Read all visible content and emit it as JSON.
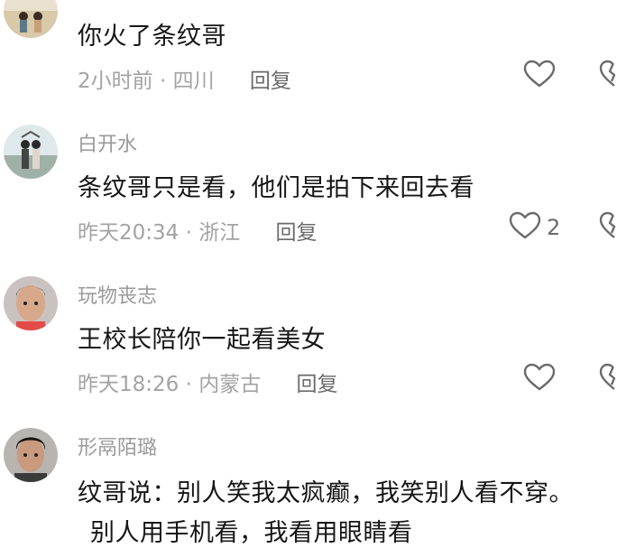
{
  "comments": [
    {
      "username": "",
      "content": "你火了条纹哥",
      "time": "2小时前",
      "location": "四川",
      "reply_label": "回复",
      "likes": ""
    },
    {
      "username": "白开水",
      "content": "条纹哥只是看，他们是拍下来回去看",
      "time": "昨天20:34",
      "location": "浙江",
      "reply_label": "回复",
      "likes": "2"
    },
    {
      "username": "玩物丧志",
      "content": "王校长陪你一起看美女",
      "time": "昨天18:26",
      "location": "内蒙古",
      "reply_label": "回复",
      "likes": ""
    },
    {
      "username": "形鬲陌璐",
      "content": "纹哥说：别人笑我太疯癫，我笑别人看不穿。",
      "content_line2": "别人用手机看，我看用眼睛看",
      "time": "",
      "location": "",
      "reply_label": "",
      "likes": ""
    }
  ],
  "separator": "·",
  "icons": {
    "like": "heart-outline-icon",
    "dislike": "broken-heart-icon"
  },
  "colors": {
    "text": "#161616",
    "meta": "#a3a3a3",
    "username": "#9a9a9a"
  }
}
